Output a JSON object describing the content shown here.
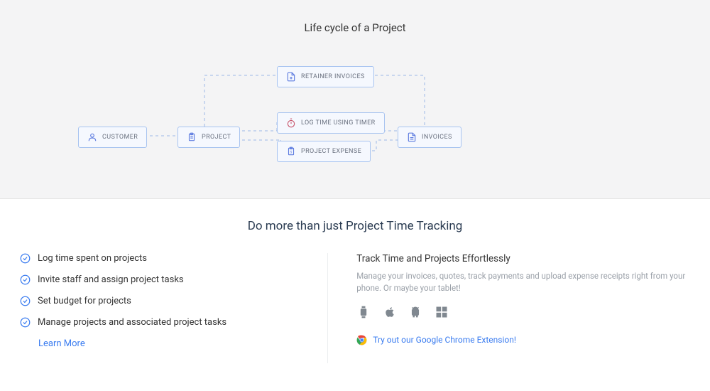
{
  "diagram": {
    "title": "Life cycle of a Project",
    "nodes": {
      "customer": "CUSTOMER",
      "project": "PROJECT",
      "retainer": "RETAINER INVOICES",
      "timer": "LOG TIME USING TIMER",
      "expense": "PROJECT EXPENSE",
      "invoices": "INVOICES"
    }
  },
  "bottom": {
    "title": "Do more than just Project Time Tracking",
    "features": [
      "Log time spent on projects",
      "Invite staff and assign project tasks",
      "Set budget for projects",
      "Manage projects and associated project tasks"
    ],
    "learn_more": "Learn More",
    "right_heading": "Track Time and Projects Effortlessly",
    "right_desc": "Manage your invoices, quotes, track payments and upload expense receipts right from your phone. Or maybe your tablet!",
    "chrome_link": "Try out our Google Chrome Extension!"
  }
}
